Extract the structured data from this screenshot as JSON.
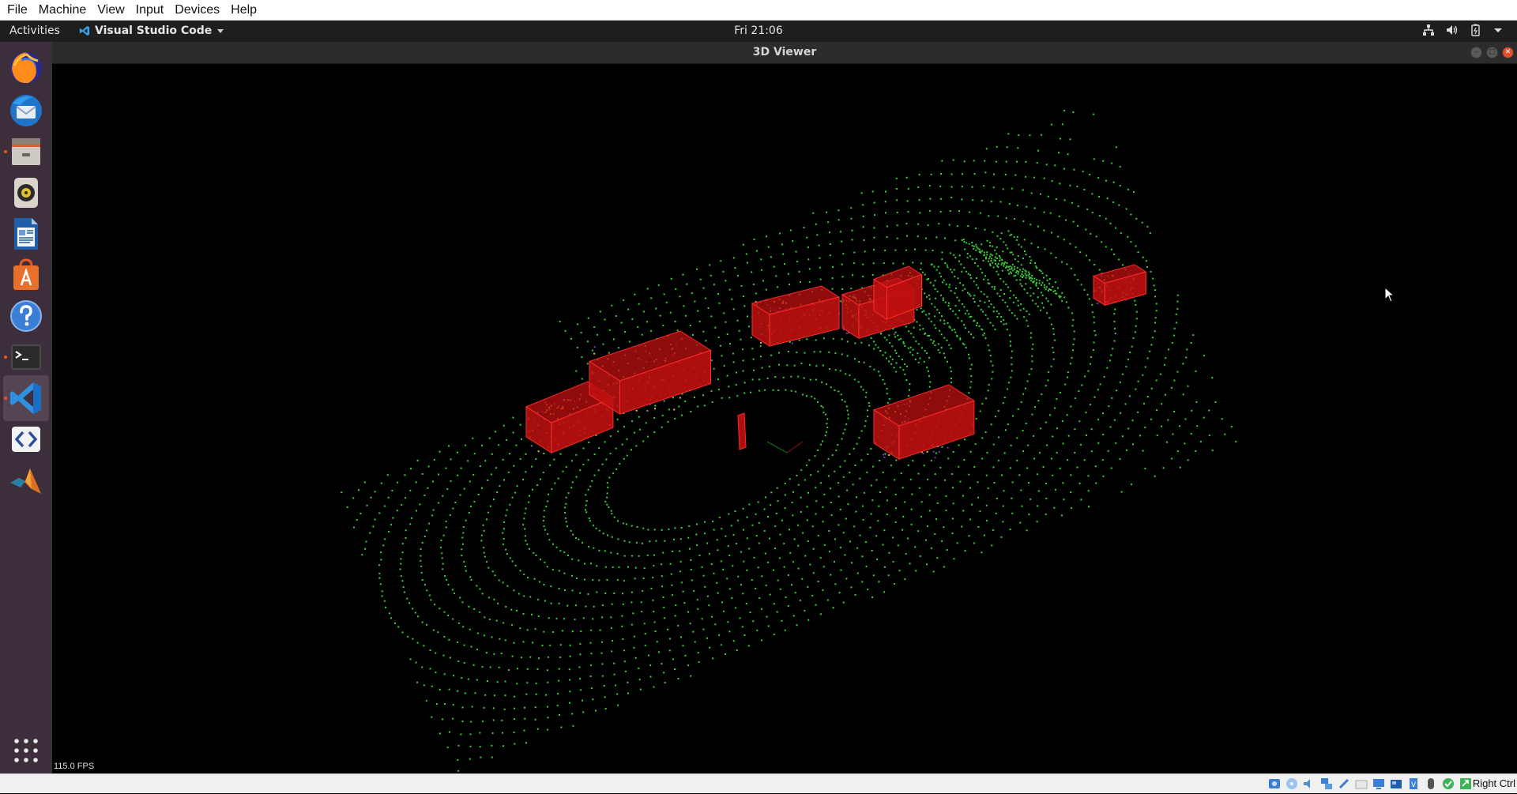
{
  "vbox_menu": [
    "File",
    "Machine",
    "View",
    "Input",
    "Devices",
    "Help"
  ],
  "topbar": {
    "activities": "Activities",
    "app_name": "Visual Studio Code",
    "clock": "Fri 21:06",
    "tray_icons": [
      "network-icon",
      "volume-icon",
      "battery-icon",
      "system-menu-arrow-icon"
    ]
  },
  "window": {
    "title": "3D Viewer",
    "controls": [
      "minimize",
      "maximize",
      "close"
    ]
  },
  "dock": {
    "apps": [
      "Firefox",
      "Thunderbird",
      "Files",
      "Rhythmbox",
      "LibreOffice Writer",
      "Ubuntu Software",
      "Help",
      "Terminal",
      "Visual Studio Code",
      "Meld",
      "MATLAB"
    ],
    "active": "Visual Studio Code",
    "show_apps": "Show Applications"
  },
  "viewer": {
    "fps_text": "115.0 FPS",
    "background": "#000000",
    "point_color": "#39d039",
    "box_color": "#c01010"
  },
  "statusbar": {
    "host_key": "Right Ctrl"
  }
}
